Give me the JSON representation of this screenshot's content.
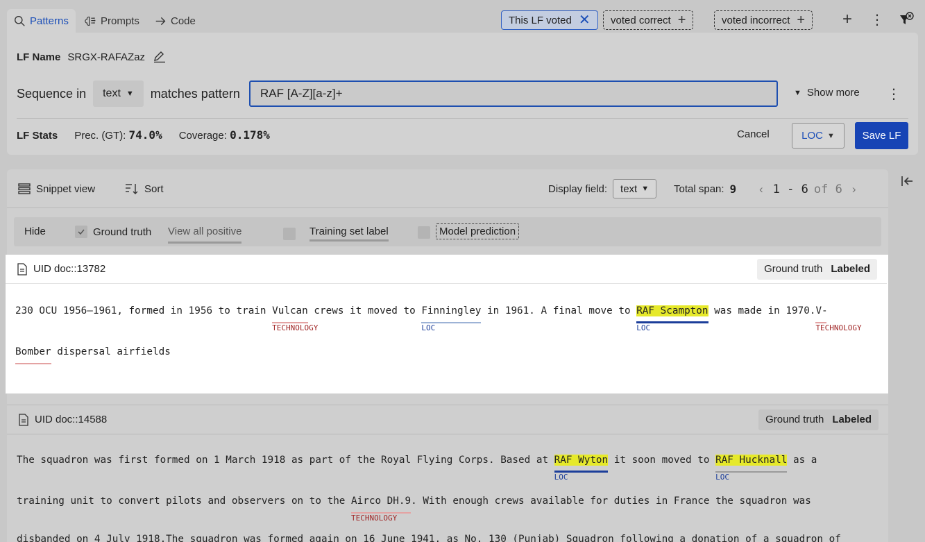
{
  "tabs": [
    {
      "label": "Patterns",
      "icon": "search-icon"
    },
    {
      "label": "Prompts",
      "icon": "brain-icon"
    },
    {
      "label": "Code",
      "icon": "arrow-right-icon"
    }
  ],
  "filter_chips": [
    {
      "label": "This LF voted",
      "state": "selected"
    },
    {
      "label": "voted correct",
      "state": "dashed"
    },
    {
      "label": "voted incorrect",
      "state": "dashed"
    }
  ],
  "lf": {
    "name_label": "LF Name",
    "name_value": "SRGX-RAFAZaz",
    "sequence_label": "Sequence in",
    "field_value": "text",
    "matches_label": "matches pattern",
    "pattern_value": "RAF [A-Z][a-z]+",
    "show_more": "Show more",
    "stats_label": "LF Stats",
    "prec_label": "Prec. (GT):",
    "prec_value": "74.0%",
    "coverage_label": "Coverage:",
    "coverage_value": "0.178%",
    "cancel_label": "Cancel",
    "class_value": "LOC",
    "save_label": "Save LF"
  },
  "results": {
    "snippet_view": "Snippet view",
    "sort": "Sort",
    "display_field_label": "Display field:",
    "display_field_value": "text",
    "total_span_label": "Total span:",
    "total_span_value": "9",
    "page_range": "1 - 6",
    "page_of": "of 6"
  },
  "filters": {
    "hide": "Hide",
    "ground_truth": "Ground truth",
    "view_all_positive": "View all positive",
    "training_set_label": "Training set label",
    "model_prediction": "Model prediction"
  },
  "docs": [
    {
      "uid": "UID doc::13782",
      "badge_label": "Ground truth",
      "badge_value": "Labeled",
      "line1": {
        "t0": "230 OCU 1956–1961, formed in 1956 to train ",
        "s1": "Vulcan",
        "s1_tag": "TECHNOLOGY",
        "t1": " crews it moved to ",
        "s2": "Finningley",
        "s2_tag": "LOC",
        "t2": " in 1961. A final move to ",
        "s3": "RAF Scampton",
        "s3_tag": "LOC",
        "t3": " was made in 1970.",
        "s4": "V-",
        "s4_tag": "TECHNOLOGY"
      },
      "line2": {
        "s1": "Bomber",
        "t1": " dispersal airfields"
      }
    },
    {
      "uid": "UID doc::14588",
      "badge_label": "Ground truth",
      "badge_value": "Labeled",
      "line1": {
        "t0": "The squadron was first formed on 1 March 1918 as part of the Royal Flying Corps. Based at ",
        "s1": "RAF Wyton",
        "s1_tag": "LOC",
        "t1": " it soon moved to ",
        "s2": "RAF Hucknall",
        "s2_tag": "LOC",
        "t2": " as a"
      },
      "line2": {
        "t0": "training unit to convert pilots and observers on to the ",
        "s1": "Airco DH.9",
        "s1_tag": "TECHNOLOGY",
        "t1": ". With enough crews available for duties in France the squadron was"
      },
      "line3": "disbanded on 4 July 1918.The squadron was formed again on 16 June 1941, as No. 130 (Punjab) Squadron following a donation of a squadron of"
    }
  ]
}
